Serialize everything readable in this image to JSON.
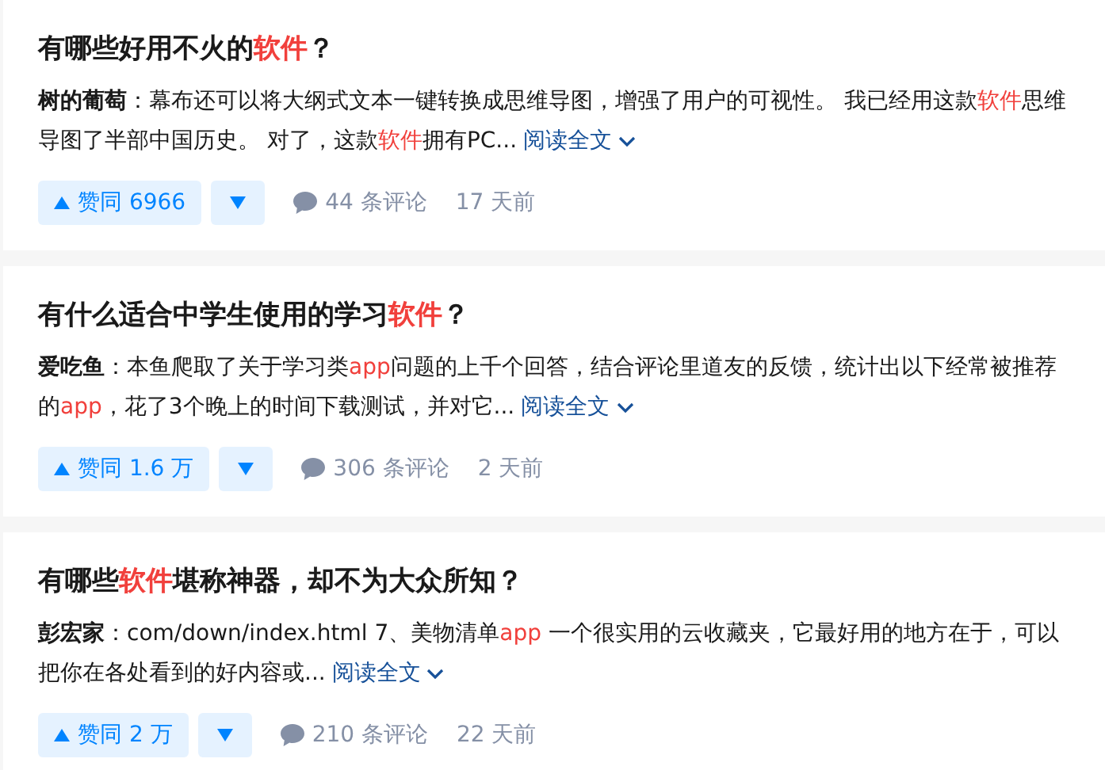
{
  "cards": [
    {
      "title": [
        {
          "text": "有哪些好用不火的",
          "highlight": false
        },
        {
          "text": "软件",
          "highlight": true
        },
        {
          "text": "？",
          "highlight": false
        }
      ],
      "author": "树的葡萄",
      "excerpt": [
        {
          "text": "：幕布还可以将大纲式文本一键转换成思维导图，增强了用户的可视性。 我已经用这款",
          "highlight": false
        },
        {
          "text": "软件",
          "highlight": true
        },
        {
          "text": "思维导图了半部中国历史。 对了，这款",
          "highlight": false
        },
        {
          "text": "软件",
          "highlight": true
        },
        {
          "text": "拥有PC...",
          "highlight": false
        }
      ],
      "read_more": "阅读全文",
      "upvote": "赞同 6966",
      "comments": "44 条评论",
      "time": "17 天前"
    },
    {
      "title": [
        {
          "text": "有什么适合中学生使用的学习",
          "highlight": false
        },
        {
          "text": "软件",
          "highlight": true
        },
        {
          "text": "？",
          "highlight": false
        }
      ],
      "author": "爱吃鱼",
      "excerpt": [
        {
          "text": "：本鱼爬取了关于学习类",
          "highlight": false
        },
        {
          "text": "app",
          "highlight": true
        },
        {
          "text": "问题的上千个回答，结合评论里道友的反馈，统计出以下经常被推荐的",
          "highlight": false
        },
        {
          "text": "app",
          "highlight": true
        },
        {
          "text": "，花了3个晚上的时间下载测试，并对它...",
          "highlight": false
        }
      ],
      "read_more": "阅读全文",
      "upvote": "赞同 1.6 万",
      "comments": "306 条评论",
      "time": "2 天前"
    },
    {
      "title": [
        {
          "text": "有哪些",
          "highlight": false
        },
        {
          "text": "软件",
          "highlight": true
        },
        {
          "text": "堪称神器，却不为大众所知？",
          "highlight": false
        }
      ],
      "author": "彭宏家",
      "excerpt": [
        {
          "text": "：com/down/index.html 7、美物清单",
          "highlight": false
        },
        {
          "text": "app",
          "highlight": true
        },
        {
          "text": " 一个很实用的云收藏夹，它最好用的地方在于，可以把你在各处看到的好内容或...",
          "highlight": false
        }
      ],
      "read_more": "阅读全文",
      "upvote": "赞同 2 万",
      "comments": "210 条评论",
      "time": "22 天前"
    }
  ]
}
